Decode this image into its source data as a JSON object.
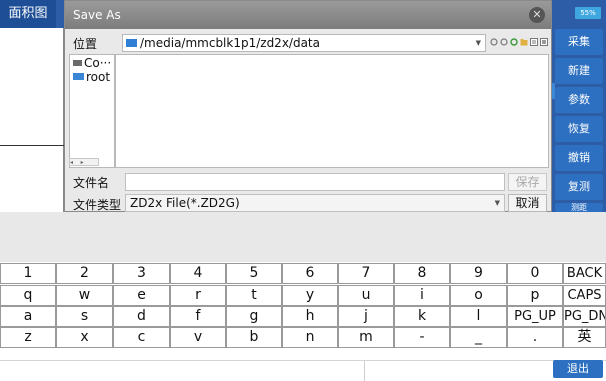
{
  "app": {
    "title": "面积图",
    "battery": "55%",
    "side_buttons": [
      "采集",
      "新建",
      "参数",
      "恢复",
      "撤销",
      "复测",
      "测距"
    ],
    "exit_label": "退出"
  },
  "dialog": {
    "title": "Save As",
    "location_label": "位置",
    "path": "/media/mmcblk1p1/zd2x/data",
    "tree_items": [
      "Co···",
      "root"
    ],
    "filename_label": "文件名",
    "filename_value": "",
    "save_label": "保存",
    "filetype_label": "文件类型",
    "filetype_value": "ZD2x File(*.ZD2G)",
    "cancel_label": "取消"
  },
  "keyboard": {
    "rows": [
      [
        "1",
        "2",
        "3",
        "4",
        "5",
        "6",
        "7",
        "8",
        "9",
        "0",
        "BACK"
      ],
      [
        "q",
        "w",
        "e",
        "r",
        "t",
        "y",
        "u",
        "i",
        "o",
        "p",
        "CAPS"
      ],
      [
        "a",
        "s",
        "d",
        "f",
        "g",
        "h",
        "j",
        "k",
        "l",
        "PG_UP",
        "PG_DN"
      ],
      [
        "z",
        "x",
        "c",
        "v",
        "b",
        "n",
        "m",
        "-",
        "_",
        ".",
        "英"
      ]
    ]
  },
  "colors": {
    "app_blue": "#2c5da6",
    "button_blue": "#2d6fc0",
    "dialog_bg": "#e9e9e9"
  }
}
